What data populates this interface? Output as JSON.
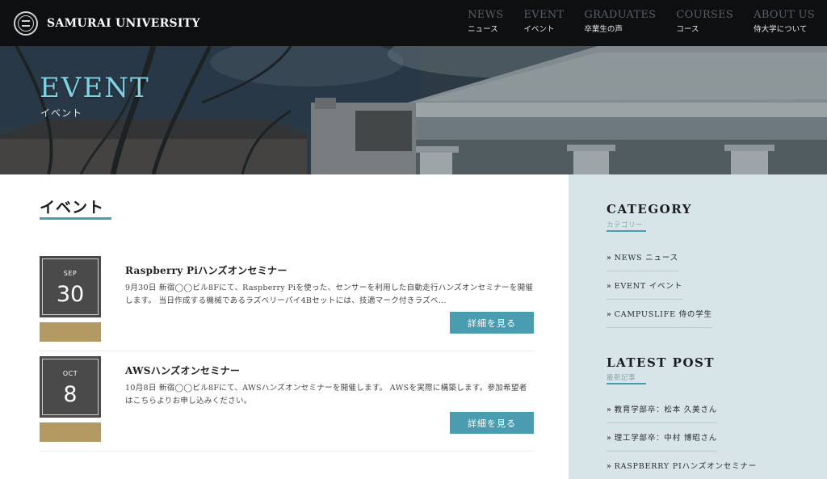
{
  "header": {
    "site_name": "SAMURAI UNIVERSITY",
    "nav": [
      {
        "en": "NEWS",
        "jp": "ニュース"
      },
      {
        "en": "EVENT",
        "jp": "イベント"
      },
      {
        "en": "GRADUATES",
        "jp": "卒業生の声"
      },
      {
        "en": "COURSES",
        "jp": "コース"
      },
      {
        "en": "ABOUT US",
        "jp": "侍大学について"
      }
    ]
  },
  "hero": {
    "title": "EVENT",
    "subtitle": "イベント"
  },
  "main": {
    "page_title": "イベント",
    "events": [
      {
        "month": "SEP",
        "day": "30",
        "title": "Raspberry Piハンズオンセミナー",
        "text": "9月30日 新宿◯◯ビル8Fにて、Raspberry Piを使った、センサーを利用した自動走行ハンズオンセミナーを開催します。 当日作成する機械であるラズベリーパイ4Bセットには、技適マーク付きラズベ...",
        "button": "詳細を見る"
      },
      {
        "month": "OCT",
        "day": "8",
        "title": "AWSハンズオンセミナー",
        "text": "10月8日 新宿◯◯ビル8Fにて、AWSハンズオンセミナーを開催します。 AWSを実際に構築します。参加希望者はこちらよりお申し込みください。",
        "button": "詳細を見る"
      }
    ]
  },
  "sidebar": {
    "category_title": "CATEGORY",
    "category_sub": "カテゴリー",
    "categories": [
      "NEWS ニュース",
      "EVENT イベント",
      "CAMPUSLIFE 侍の学生"
    ],
    "latest_title": "LATEST POST",
    "latest_sub": "最新記事",
    "latest": [
      "教育学部卒：松本 久美さん",
      "理工学部卒：中村 博昭さん",
      "RASPBERRY PIハンズオンセミナー"
    ],
    "chevron": "»"
  },
  "colors": {
    "accent": "#4a9db0",
    "gold": "#b39a63",
    "header_bg": "#0e0f10",
    "sidebar_bg": "#d7e5e8"
  }
}
